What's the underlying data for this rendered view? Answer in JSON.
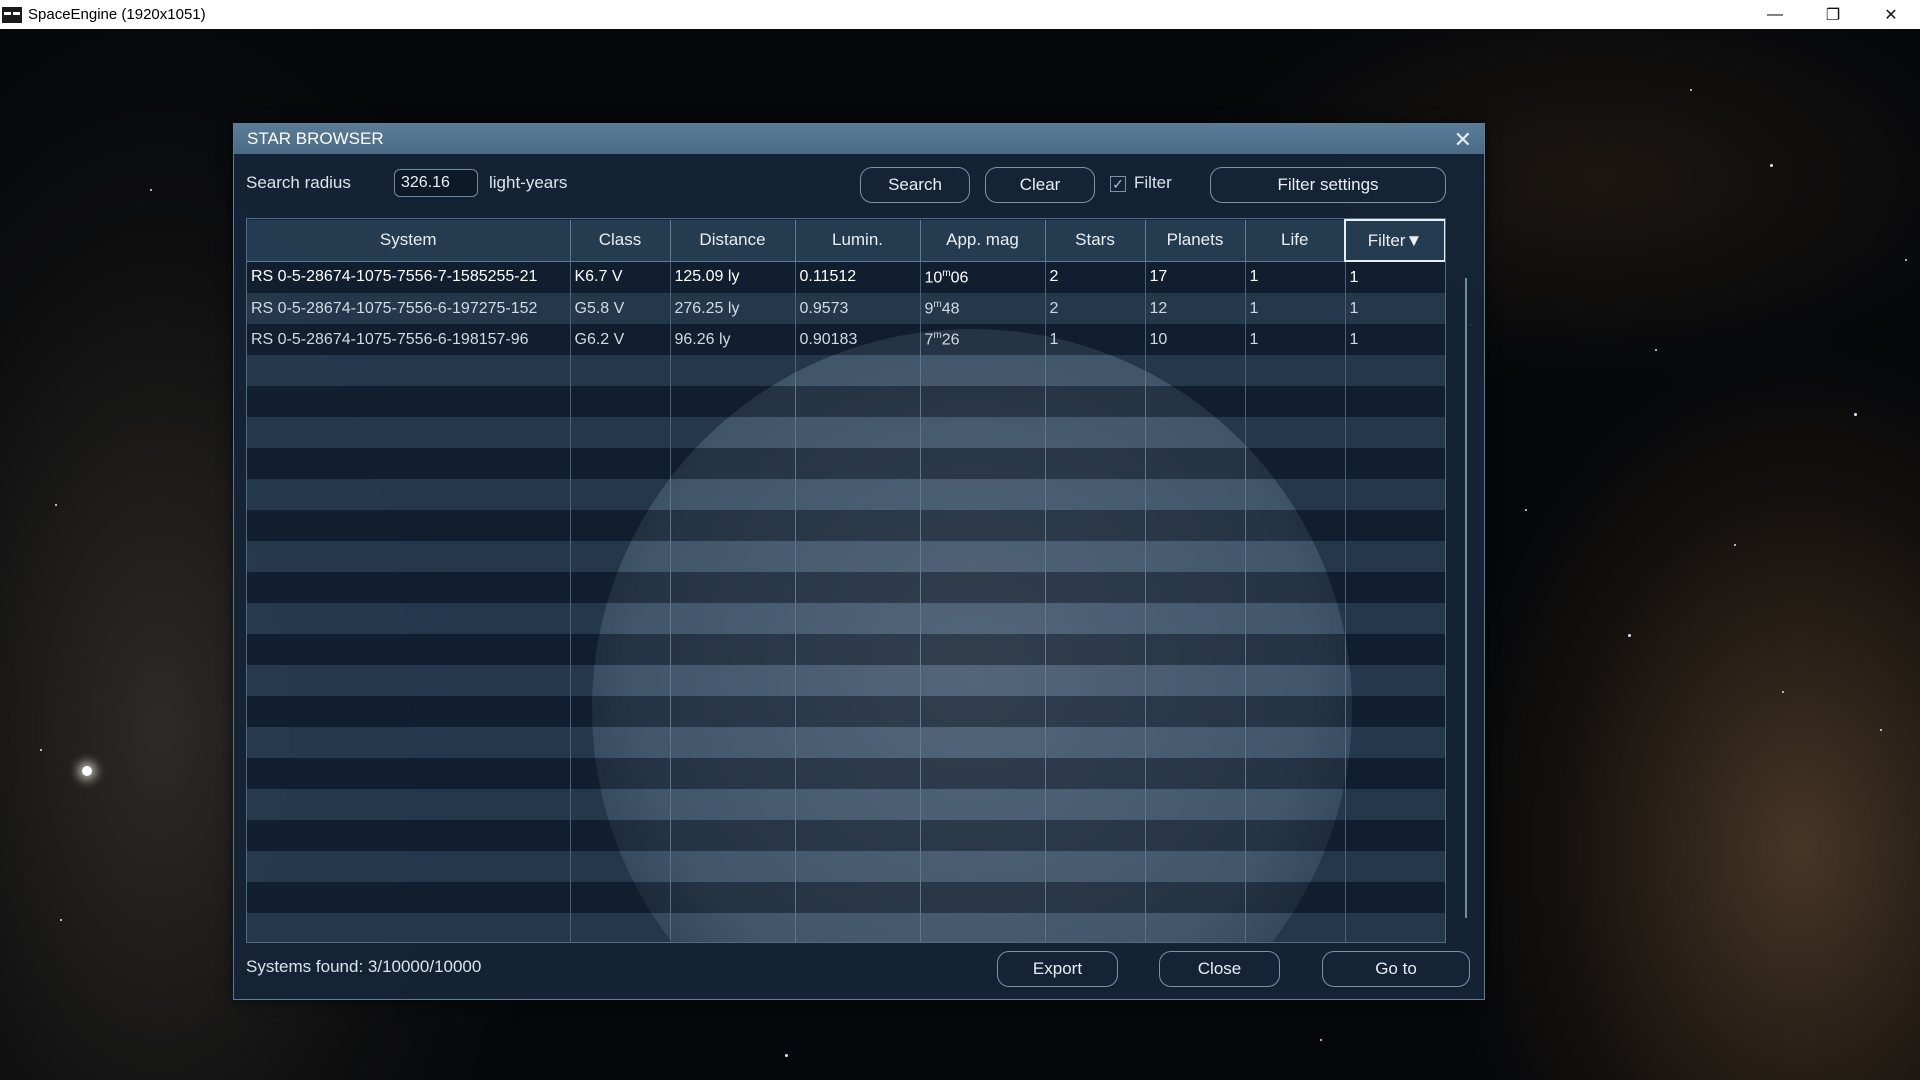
{
  "window": {
    "title": "SpaceEngine (1920x1051)",
    "controls": {
      "minimize": "—",
      "restore": "❐",
      "close": "✕"
    }
  },
  "dialog": {
    "title": "STAR BROWSER",
    "close_glyph": "✕",
    "search_radius_label": "Search radius",
    "search_radius_value": "326.16",
    "units": "light-years",
    "search_button": "Search",
    "clear_button": "Clear",
    "filter_checked": true,
    "filter_label": "Filter",
    "filter_settings_button": "Filter settings",
    "table": {
      "columns": [
        "System",
        "Class",
        "Distance",
        "Lumin.",
        "App. mag",
        "Stars",
        "Planets",
        "Life",
        "Filter▼"
      ],
      "rows": [
        {
          "system": "RS 0-5-28674-1075-7556-7-1585255-21",
          "class": "K6.7 V",
          "distance": "125.09 ly",
          "lumin": "0.11512",
          "appmag_int": "10",
          "appmag_frac": "06",
          "stars": "2",
          "planets": "17",
          "life": "1",
          "filter": "1"
        },
        {
          "system": "RS 0-5-28674-1075-7556-6-197275-152",
          "class": "G5.8 V",
          "distance": "276.25 ly",
          "lumin": "0.9573",
          "appmag_int": "9",
          "appmag_frac": "48",
          "stars": "2",
          "planets": "12",
          "life": "1",
          "filter": "1"
        },
        {
          "system": "RS 0-5-28674-1075-7556-6-198157-96",
          "class": "G6.2 V",
          "distance": "96.26 ly",
          "lumin": "0.90183",
          "appmag_int": "7",
          "appmag_frac": "26",
          "stars": "1",
          "planets": "10",
          "life": "1",
          "filter": "1"
        }
      ],
      "mag_unit": "m"
    },
    "status": "Systems found: 3/10000/10000",
    "export_button": "Export",
    "close_button": "Close",
    "goto_button": "Go to"
  }
}
